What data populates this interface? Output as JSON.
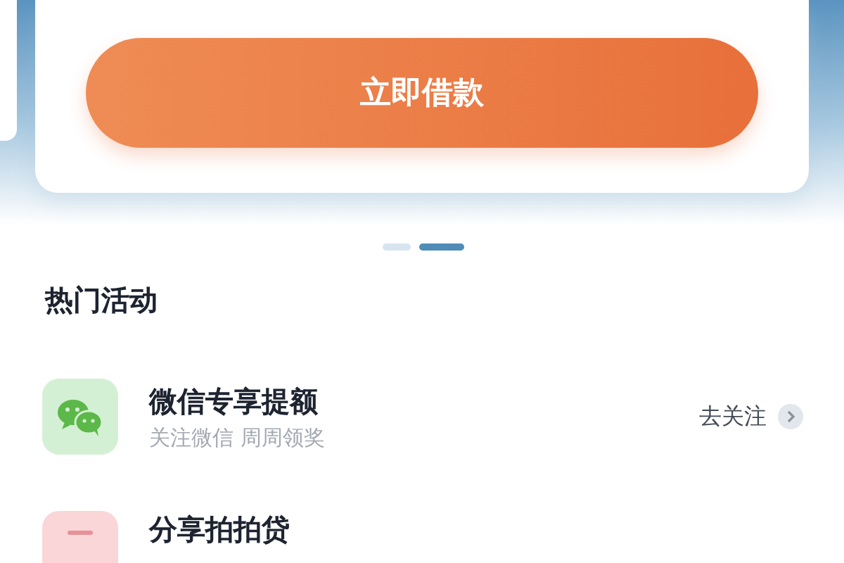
{
  "loan_card": {
    "button": "立即借款"
  },
  "pager": [
    {
      "selected": false
    },
    {
      "selected": true
    }
  ],
  "section": {
    "title": "热门活动"
  },
  "activities": [
    {
      "kind": "wechat",
      "title": "微信专享提额",
      "subtitle": "关注微信 周周领奖",
      "action": "去关注"
    },
    {
      "kind": "share",
      "title": "分享拍拍贷"
    }
  ]
}
